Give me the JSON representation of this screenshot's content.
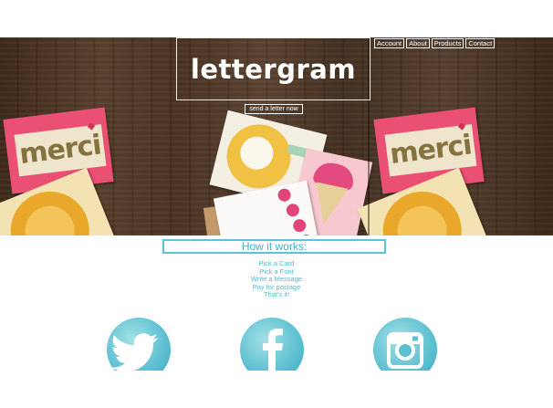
{
  "header": {
    "logo": "lettergram",
    "cta_label": "send a letter now",
    "nav": [
      "Account",
      "About",
      "Products",
      "Contact"
    ]
  },
  "hero": {
    "merci_card_text": "merci"
  },
  "how_it_works": {
    "title": "How it works:",
    "steps": [
      "Pick a Card",
      "Pick a Font",
      "Write a Message",
      "Pay for postage",
      "That's it!"
    ]
  },
  "social": [
    {
      "icon": "twitter-icon"
    },
    {
      "icon": "facebook-icon"
    },
    {
      "icon": "instagram-icon"
    }
  ],
  "colors": {
    "accent": "#4dbbd0",
    "accent_border": "#5bc4d6",
    "social_blue": "#5cc0d2",
    "wood": "#4a3423"
  }
}
